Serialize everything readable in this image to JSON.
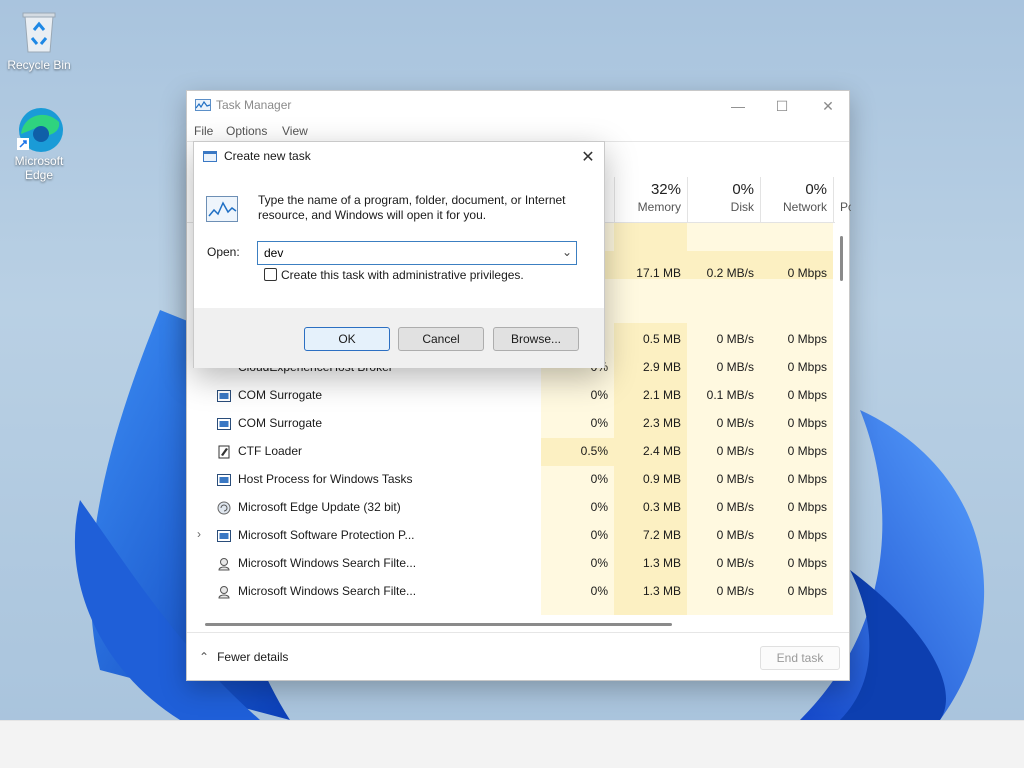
{
  "desktop": {
    "icons": [
      {
        "label": "Recycle Bin",
        "icon": "recycle-bin-icon"
      },
      {
        "label": "Microsoft Edge",
        "icon": "edge-icon"
      }
    ]
  },
  "task_manager": {
    "title": "Task Manager",
    "menu": [
      "File",
      "Options",
      "View"
    ],
    "columns": [
      {
        "pct": "",
        "label": ""
      },
      {
        "pct": "32%",
        "label": "Memory"
      },
      {
        "pct": "0%",
        "label": "Disk"
      },
      {
        "pct": "0%",
        "label": "Network"
      },
      {
        "pct": "",
        "label": "Po"
      }
    ],
    "rows": [
      {
        "name": "",
        "cpu": "",
        "memory": "17.1 MB",
        "disk": "0.2 MB/s",
        "network": "0 Mbps"
      },
      {
        "name": "",
        "cpu": "",
        "memory": "0.5 MB",
        "disk": "0 MB/s",
        "network": "0 Mbps"
      },
      {
        "name": "CloudExperienceHost Broker",
        "cpu": "0%",
        "memory": "2.9 MB",
        "disk": "0 MB/s",
        "network": "0 Mbps"
      },
      {
        "name": "COM Surrogate",
        "cpu": "0%",
        "memory": "2.1 MB",
        "disk": "0.1 MB/s",
        "network": "0 Mbps"
      },
      {
        "name": "COM Surrogate",
        "cpu": "0%",
        "memory": "2.3 MB",
        "disk": "0 MB/s",
        "network": "0 Mbps"
      },
      {
        "name": "CTF Loader",
        "cpu": "0.5%",
        "memory": "2.4 MB",
        "disk": "0 MB/s",
        "network": "0 Mbps"
      },
      {
        "name": "Host Process for Windows Tasks",
        "cpu": "0%",
        "memory": "0.9 MB",
        "disk": "0 MB/s",
        "network": "0 Mbps"
      },
      {
        "name": "Microsoft Edge Update (32 bit)",
        "cpu": "0%",
        "memory": "0.3 MB",
        "disk": "0 MB/s",
        "network": "0 Mbps"
      },
      {
        "name": "Microsoft Software Protection P...",
        "cpu": "0%",
        "memory": "7.2 MB",
        "disk": "0 MB/s",
        "network": "0 Mbps"
      },
      {
        "name": "Microsoft Windows Search Filte...",
        "cpu": "0%",
        "memory": "1.3 MB",
        "disk": "0 MB/s",
        "network": "0 Mbps"
      },
      {
        "name": "Microsoft Windows Search Filte...",
        "cpu": "0%",
        "memory": "1.3 MB",
        "disk": "0 MB/s",
        "network": "0 Mbps"
      }
    ],
    "fewer_details": "Fewer details",
    "end_task": "End task"
  },
  "run_dialog": {
    "title": "Create new task",
    "description": "Type the name of a program, folder, document, or Internet resource, and Windows will open it for you.",
    "open_label": "Open:",
    "open_value": "dev",
    "admin_label": "Create this task with administrative privileges.",
    "ok": "OK",
    "cancel": "Cancel",
    "browse": "Browse..."
  },
  "colors": {
    "heat_light": "#fff9e0",
    "heat_mid": "#fcf0c2",
    "accent": "#2b6fc2"
  }
}
